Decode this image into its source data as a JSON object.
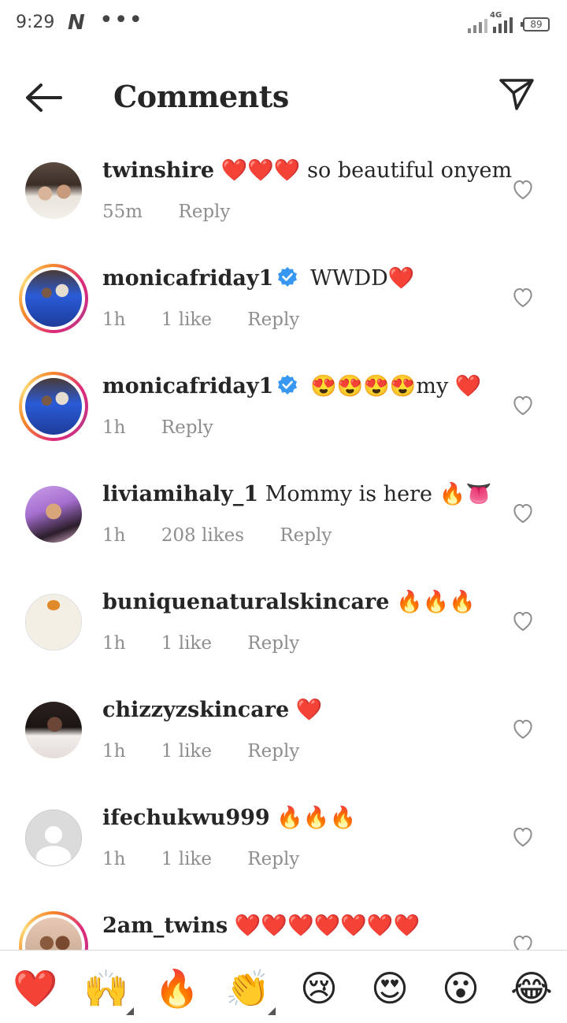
{
  "status_bar": {
    "time": "9:29",
    "carrier_icon": "N",
    "more_dots": "•••",
    "network": "4G",
    "battery": "89"
  },
  "header": {
    "title": "Comments",
    "back_icon": "arrow-left-icon",
    "send_icon": "send-icon"
  },
  "comments": [
    {
      "username": "twinshire",
      "verified": false,
      "text": "❤️❤️❤️ so beautiful onyem",
      "time": "55m",
      "likes": "",
      "reply_label": "Reply",
      "story_ring": false
    },
    {
      "username": "monicafriday1",
      "verified": true,
      "text": "WWDD❤️",
      "time": "1h",
      "likes": "1 like",
      "reply_label": "Reply",
      "story_ring": true
    },
    {
      "username": "monicafriday1",
      "verified": true,
      "text": "😍😍😍😍my ❤️",
      "time": "1h",
      "likes": "",
      "reply_label": "Reply",
      "story_ring": true
    },
    {
      "username": "liviamihaly_1",
      "verified": false,
      "text": "Mommy is here 🔥👅",
      "time": "1h",
      "likes": "208 likes",
      "reply_label": "Reply",
      "story_ring": false
    },
    {
      "username": "buniquenaturalskincare",
      "verified": false,
      "text": "🔥🔥🔥",
      "time": "1h",
      "likes": "1 like",
      "reply_label": "Reply",
      "story_ring": false
    },
    {
      "username": "chizzyzskincare",
      "verified": false,
      "text": "❤️",
      "time": "1h",
      "likes": "1 like",
      "reply_label": "Reply",
      "story_ring": false
    },
    {
      "username": "ifechukwu999",
      "verified": false,
      "text": "🔥🔥🔥",
      "time": "1h",
      "likes": "1 like",
      "reply_label": "Reply",
      "story_ring": false
    },
    {
      "username": "2am_twins",
      "verified": false,
      "text": "❤️❤️❤️❤️❤️❤️❤️",
      "time": "",
      "likes": "",
      "reply_label": "",
      "story_ring": true
    }
  ],
  "emoji_bar": [
    "❤️",
    "🙌",
    "🔥",
    "👏",
    "😢",
    "😍",
    "😮",
    "😂"
  ],
  "colors": {
    "text": "#262626",
    "secondary": "#8e8e8e",
    "verified_blue": "#3897f0",
    "divider": "#dbdbdb"
  }
}
